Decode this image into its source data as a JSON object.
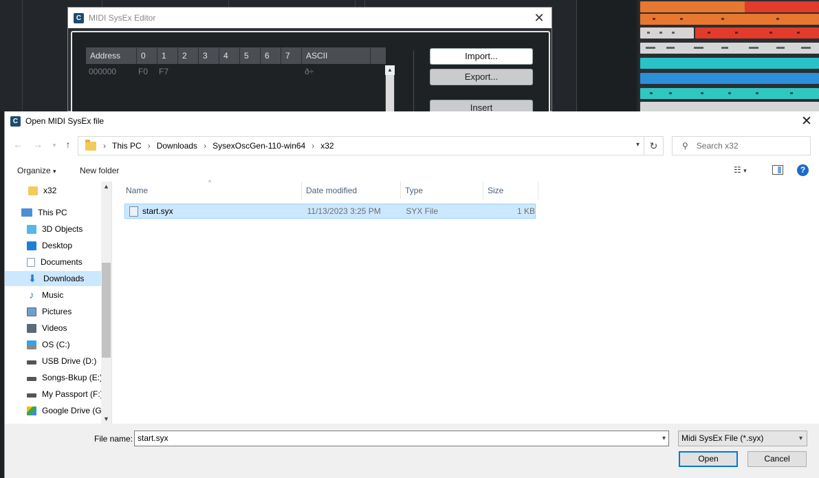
{
  "sysex_editor": {
    "title": "MIDI SysEx Editor",
    "columns": [
      "Address",
      "0",
      "1",
      "2",
      "3",
      "4",
      "5",
      "6",
      "7",
      "ASCII"
    ],
    "row": {
      "address": "000000",
      "bytes": [
        "F0",
        "F7",
        "",
        "",
        "",
        "",
        "",
        ""
      ],
      "ascii": "ð÷"
    },
    "buttons": {
      "import": "Import...",
      "export": "Export...",
      "insert": "Insert"
    }
  },
  "dialog": {
    "title": "Open MIDI SysEx file",
    "breadcrumb": [
      "This PC",
      "Downloads",
      "SysexOscGen-110-win64",
      "x32"
    ],
    "search_placeholder": "Search x32",
    "toolbar": {
      "organize": "Organize",
      "new_folder": "New folder"
    },
    "nav_items": [
      {
        "label": "x32",
        "icon": "folder-icon",
        "color": "#f3cb5a"
      },
      {
        "label": "This PC",
        "icon": "computer-icon",
        "color": "#4a8fd6"
      },
      {
        "label": "3D Objects",
        "icon": "cube-icon",
        "color": "#55b8e8"
      },
      {
        "label": "Desktop",
        "icon": "desktop-icon",
        "color": "#1e7fd8"
      },
      {
        "label": "Documents",
        "icon": "document-icon",
        "color": "#8a97a6"
      },
      {
        "label": "Downloads",
        "icon": "download-arrow-icon",
        "color": "#2b7bd6"
      },
      {
        "label": "Music",
        "icon": "music-note-icon",
        "color": "#2b7bd6"
      },
      {
        "label": "Pictures",
        "icon": "pictures-icon",
        "color": "#6ea0c9"
      },
      {
        "label": "Videos",
        "icon": "film-icon",
        "color": "#5a6a7a"
      },
      {
        "label": "OS (C:)",
        "icon": "windows-drive-icon",
        "color": "#3aa0e8"
      },
      {
        "label": "USB Drive (D:)",
        "icon": "drive-icon",
        "color": "#555555"
      },
      {
        "label": "Songs-Bkup (E:)",
        "icon": "drive-icon",
        "color": "#555555"
      },
      {
        "label": "My Passport (F:)",
        "icon": "drive-icon",
        "color": "#555555"
      },
      {
        "label": "Google Drive (G:",
        "icon": "google-drive-icon",
        "color": "#34a853"
      }
    ],
    "selected_nav": "Downloads",
    "file_columns": [
      "Name",
      "Date modified",
      "Type",
      "Size"
    ],
    "files": [
      {
        "name": "start.syx",
        "date": "11/13/2023 3:25 PM",
        "type": "SYX File",
        "size": "1 KB"
      }
    ],
    "file_name_label": "File name:",
    "file_name_value": "start.syx",
    "file_type": "Midi SysEx File (*.syx)",
    "buttons": {
      "open": "Open",
      "cancel": "Cancel"
    },
    "accent_color": "#0078d7",
    "selection_color": "#cce8ff"
  }
}
